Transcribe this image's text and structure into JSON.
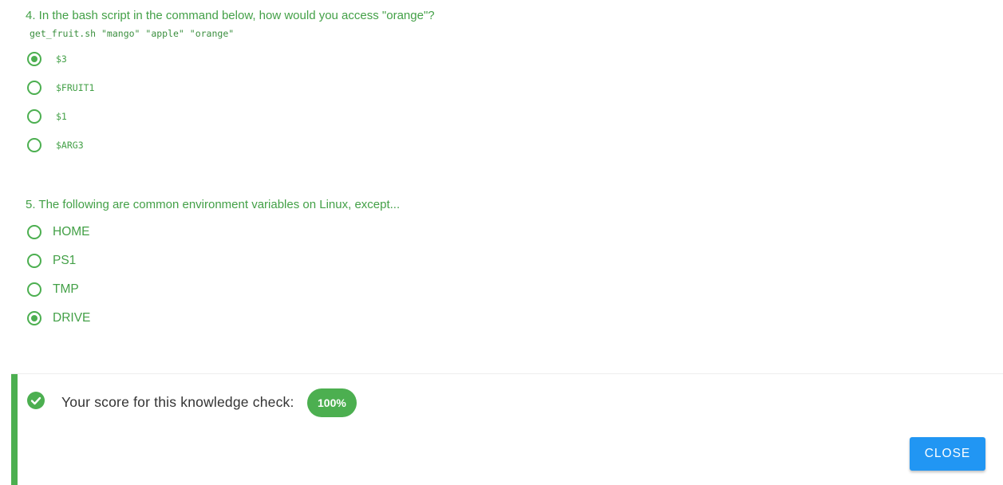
{
  "colors": {
    "accent_green": "#4caf50",
    "text_green": "#43a047",
    "button_blue": "#2196f3"
  },
  "questions": [
    {
      "text": "4. In the bash script in the command below, how would you access \"orange\"?",
      "code": "get_fruit.sh \"mango\" \"apple\" \"orange\"",
      "options": [
        {
          "label": "$3",
          "selected": true
        },
        {
          "label": "$FRUIT1",
          "selected": false
        },
        {
          "label": "$1",
          "selected": false
        },
        {
          "label": "$ARG3",
          "selected": false
        }
      ]
    },
    {
      "text": "5. The following are common environment variables on Linux, except...",
      "options": [
        {
          "label": "HOME",
          "selected": false
        },
        {
          "label": "PS1",
          "selected": false
        },
        {
          "label": "TMP",
          "selected": false
        },
        {
          "label": "DRIVE",
          "selected": true
        }
      ]
    }
  ],
  "result": {
    "icon": "check-circle-icon",
    "score_label": "Your score for this knowledge check:",
    "score_value": "100%",
    "close_label": "CLOSE"
  }
}
